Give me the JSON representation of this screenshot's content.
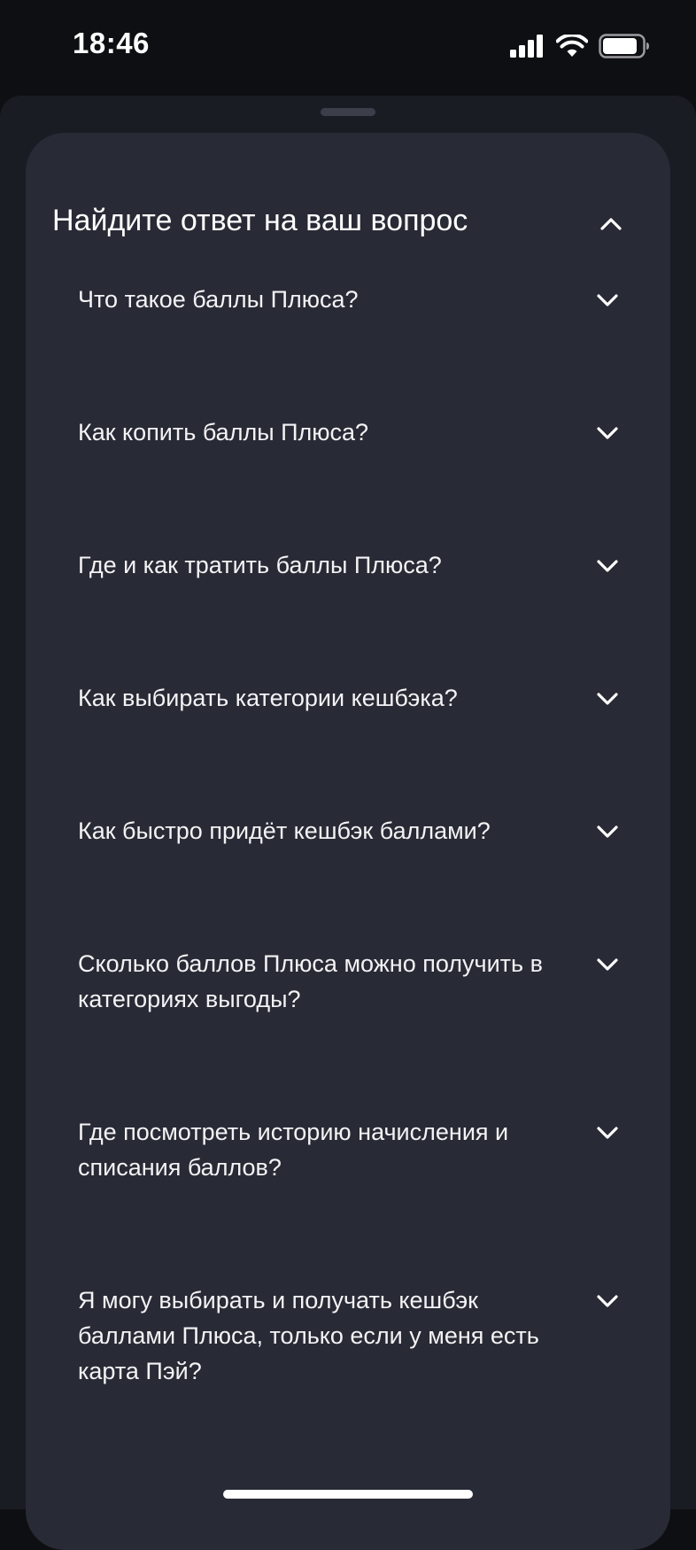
{
  "status_bar": {
    "time": "18:46"
  },
  "faq": {
    "title": "Найдите ответ на ваш вопрос",
    "items": [
      {
        "question": "Что такое баллы Плюса?"
      },
      {
        "question": "Как копить баллы Плюса?"
      },
      {
        "question": "Где и как тратить баллы Плюса?"
      },
      {
        "question": "Как выбирать категории кешбэка?"
      },
      {
        "question": "Как быстро придёт кешбэк баллами?"
      },
      {
        "question": "Сколько баллов Плюса можно получить в категориях выгоды?"
      },
      {
        "question": "Где посмотреть историю начисления и списания баллов?"
      },
      {
        "question": "Я могу выбирать и получать кешбэк баллами Плюса, только если у меня есть карта Пэй?"
      }
    ]
  },
  "icons": {
    "collapse": "chevron-up-icon",
    "expand": "chevron-down-icon"
  },
  "colors": {
    "background": "#0e0f12",
    "sheet": "#1a1c24",
    "card": "#282a35",
    "text": "#ffffff"
  }
}
